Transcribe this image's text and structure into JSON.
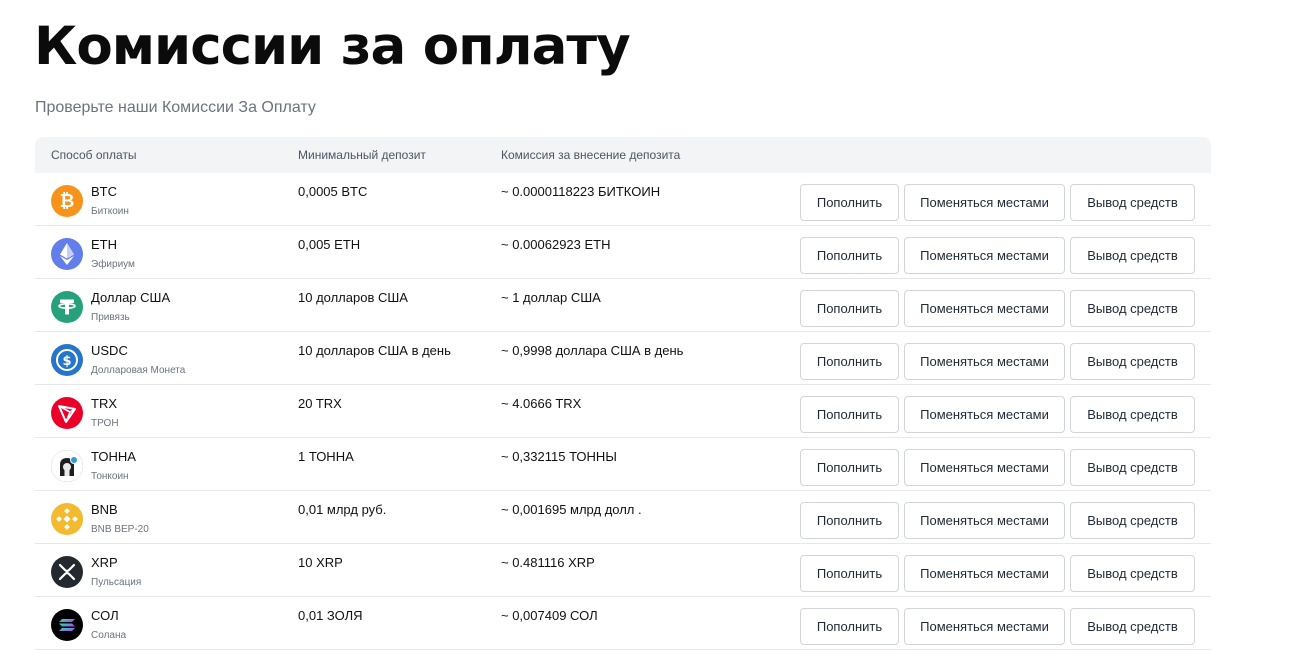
{
  "page": {
    "title": "Комиссии за оплату",
    "subtitle": "Проверьте наши Комиссии За Оплату"
  },
  "table": {
    "headers": {
      "method": "Способ оплаты",
      "min_deposit": "Минимальный депозит",
      "fee": "Комиссия за внесение депозита"
    },
    "actions": {
      "deposit": "Пополнить",
      "swap": "Поменяться местами",
      "withdraw": "Вывод средств"
    },
    "rows": [
      {
        "symbol": "BTC",
        "name": "Биткоин",
        "min_deposit": "0,0005 BTC",
        "fee": "~ 0.0000118223 БИТКОИН",
        "icon": "bitcoin-icon",
        "color": "#f7931a"
      },
      {
        "symbol": "ETH",
        "name": "Эфириум",
        "min_deposit": "0,005 ETH",
        "fee": "~ 0.00062923 ETH",
        "icon": "ethereum-icon",
        "color": "#627eea"
      },
      {
        "symbol": "Доллар США",
        "name": "Привязь",
        "min_deposit": "10 долларов США",
        "fee": "~ 1 доллар США",
        "icon": "tether-icon",
        "color": "#26a17b"
      },
      {
        "symbol": "USDC",
        "name": "Долларовая Монета",
        "min_deposit": "10 долларов США в день",
        "fee": "~ 0,9998 доллара США в день",
        "icon": "usdc-icon",
        "color": "#2775ca"
      },
      {
        "symbol": "TRX",
        "name": "ТРОН",
        "min_deposit": "20 TRX",
        "fee": "~ 4.0666 TRX",
        "icon": "tron-icon",
        "color": "#eb0029"
      },
      {
        "symbol": "ТОННА",
        "name": "Тонкоин",
        "min_deposit": "1 ТОННА",
        "fee": "~ 0,332115 ТОННЫ",
        "icon": "toncoin-icon",
        "color": "#1e1e1e"
      },
      {
        "symbol": "BNB",
        "name": "BNB BEP-20",
        "min_deposit": "0,01 млрд руб.",
        "fee": "~ 0,001695 млрд долл .",
        "icon": "bnb-icon",
        "color": "#f3ba2f"
      },
      {
        "symbol": "XRP",
        "name": "Пульсация",
        "min_deposit": "10 XRP",
        "fee": "~ 0.481116 XRP",
        "icon": "xrp-icon",
        "color": "#23292f"
      },
      {
        "symbol": "СОЛ",
        "name": "Солана",
        "min_deposit": "0,01 ЗОЛЯ",
        "fee": "~ 0,007409 СОЛ",
        "icon": "solana-icon",
        "color": "#000000"
      }
    ]
  }
}
